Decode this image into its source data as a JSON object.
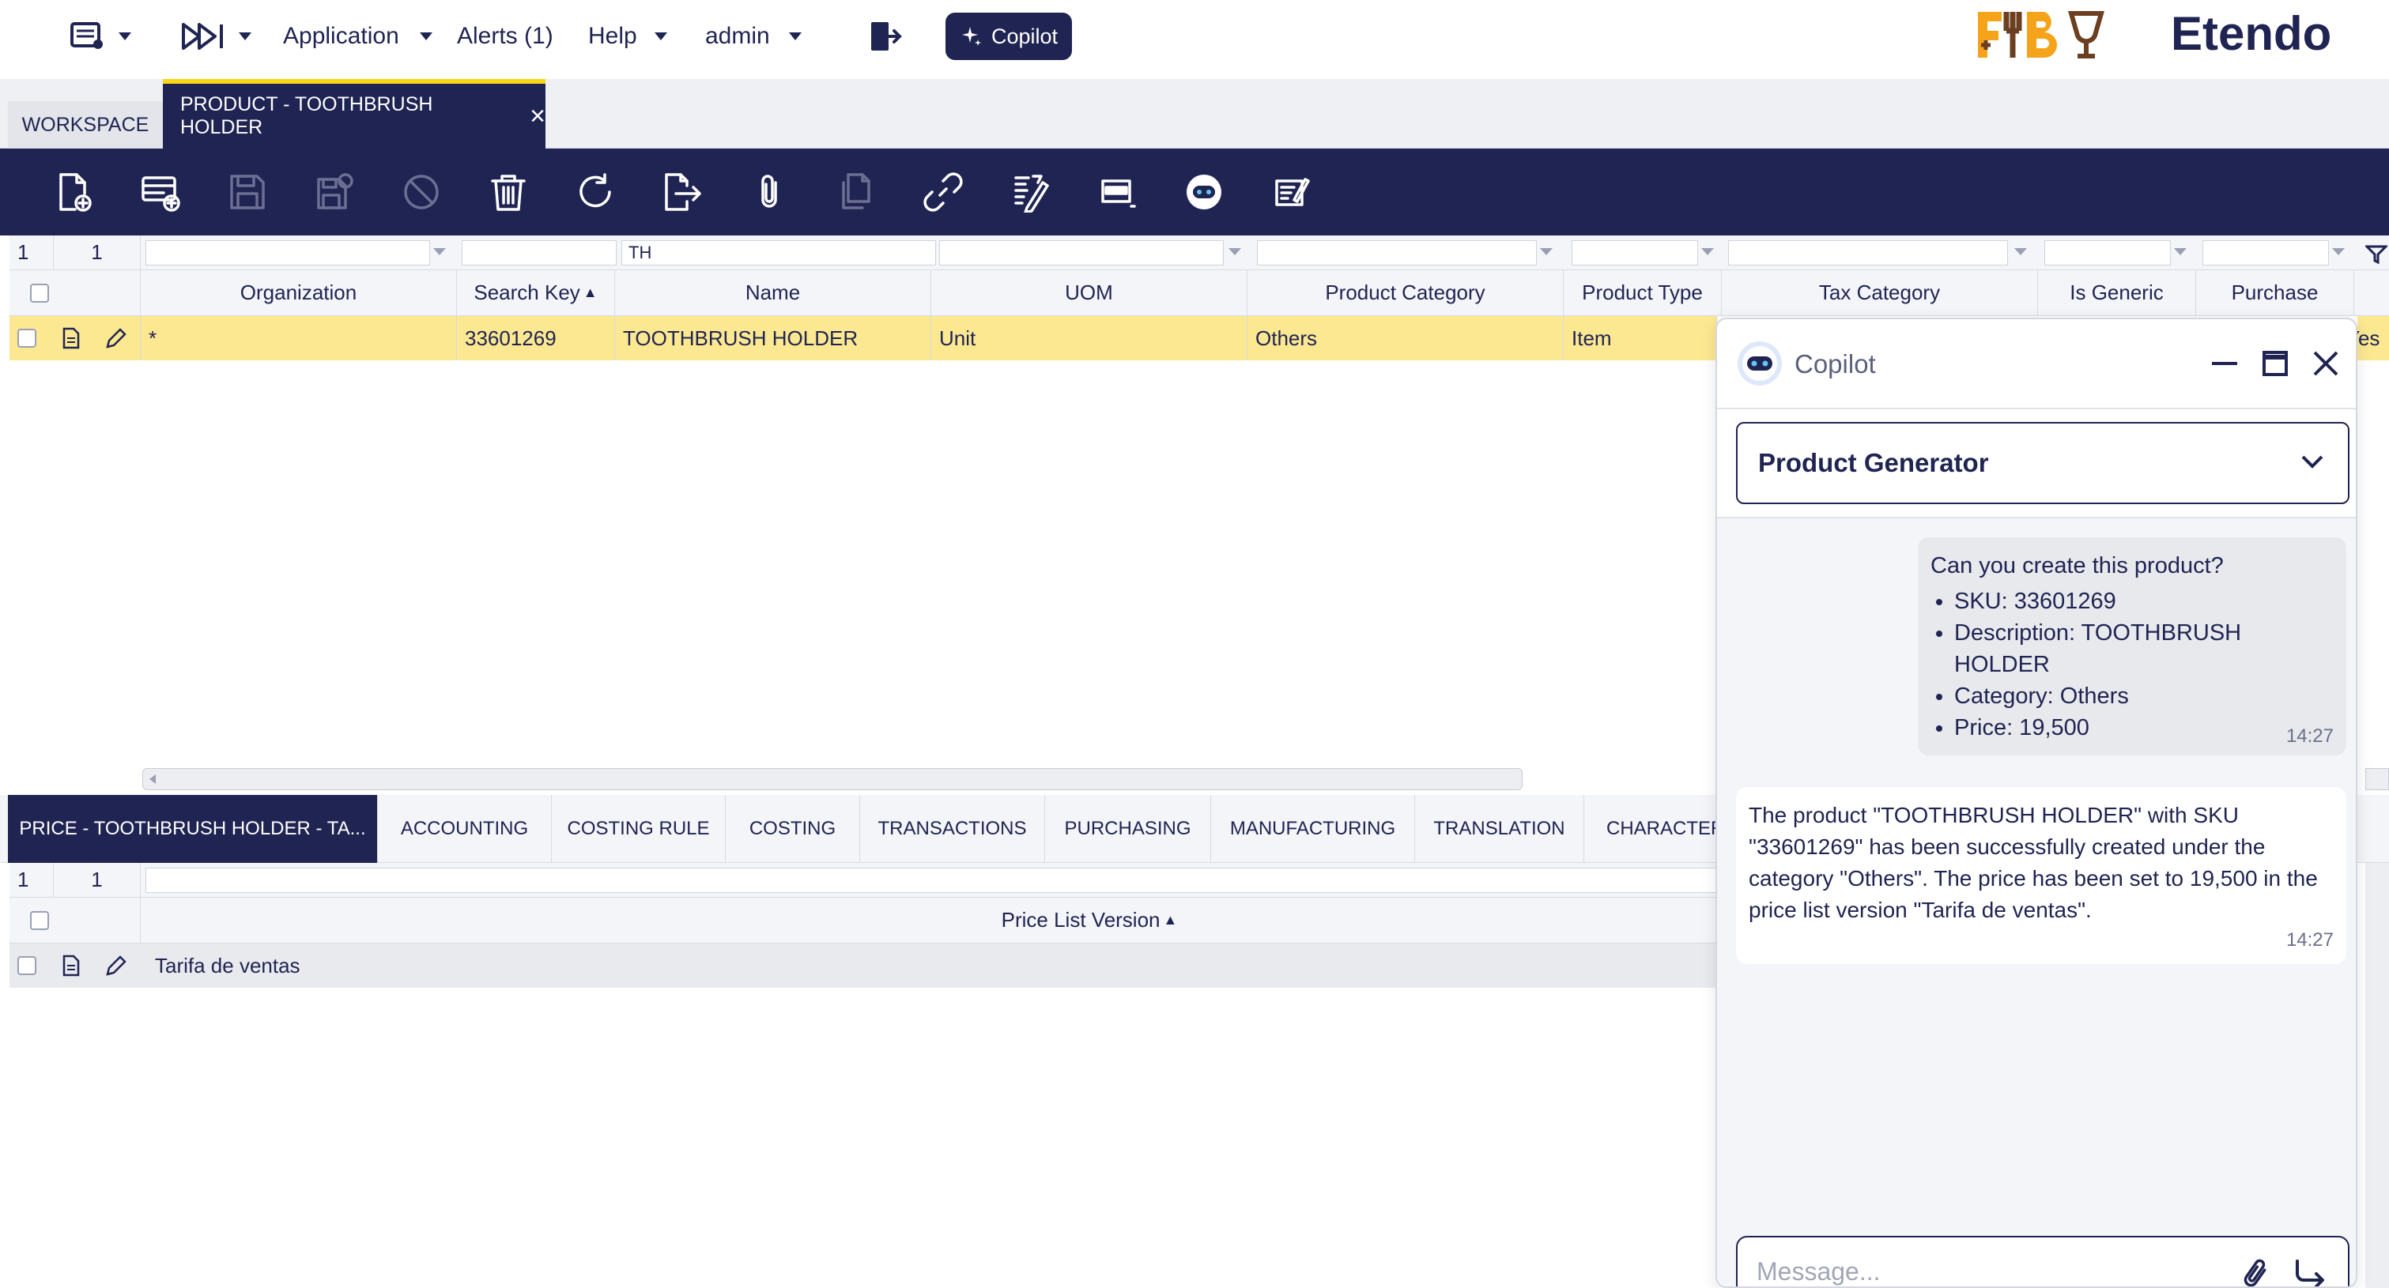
{
  "topbar": {
    "application": "Application",
    "alerts": "Alerts (1)",
    "help": "Help",
    "user": "admin",
    "copilot": "Copilot",
    "brand": "FMBY",
    "etendo": "Etendo"
  },
  "tabs": {
    "workspace": "WORKSPACE",
    "product": "PRODUCT - TOOTHBRUSH HOLDER",
    "close": "×"
  },
  "toolbar_icons": [
    "new-document-icon",
    "new-row-icon",
    "save-icon",
    "save-close-icon",
    "cancel-icon",
    "delete-icon",
    "refresh-icon",
    "export-icon",
    "attach-icon",
    "clone-icon",
    "link-icon",
    "audit-icon",
    "toggle-form-icon",
    "copilot-robot-icon",
    "process-icon"
  ],
  "grid": {
    "count_a": "1",
    "count_b": "1",
    "name_filter": "TH",
    "columns": [
      "Organization",
      "Search Key",
      "Name",
      "UOM",
      "Product Category",
      "Product Type",
      "Tax Category",
      "Is Generic",
      "Purchase"
    ],
    "sort_arrow": "▲",
    "row": {
      "organization": "*",
      "search_key": "33601269",
      "name": "TOOTHBRUSH HOLDER",
      "uom": "Unit",
      "category": "Others",
      "type": "Item",
      "purchase": "Yes"
    }
  },
  "subtabs": [
    "PRICE - TOOTHBRUSH HOLDER - TA...",
    "ACCOUNTING",
    "COSTING RULE",
    "COSTING",
    "TRANSACTIONS",
    "PURCHASING",
    "MANUFACTURING",
    "TRANSLATION",
    "CHARACTER"
  ],
  "subgrid": {
    "count_a": "1",
    "count_b": "1",
    "column": "Price List Version",
    "row": "Tarifa de ventas"
  },
  "copilot": {
    "title": "Copilot",
    "assistant": "Product Generator",
    "user_message": {
      "intro": "Can you create this product?",
      "items": [
        "SKU: 33601269",
        "Description: TOOTHBRUSH HOLDER",
        "Category: Others",
        "Price: 19,500"
      ],
      "time": "14:27"
    },
    "bot_message": {
      "text": "The product \"TOOTHBRUSH HOLDER\" with SKU \"33601269\" has been successfully created under the category \"Others\". The price has been set to 19,500 in the price list version \"Tarifa de ventas\".",
      "time": "14:27"
    },
    "input_placeholder": "Message..."
  },
  "colors": {
    "navy": "#202452",
    "yellow": "#fad614",
    "row_highlight": "#fce891"
  }
}
